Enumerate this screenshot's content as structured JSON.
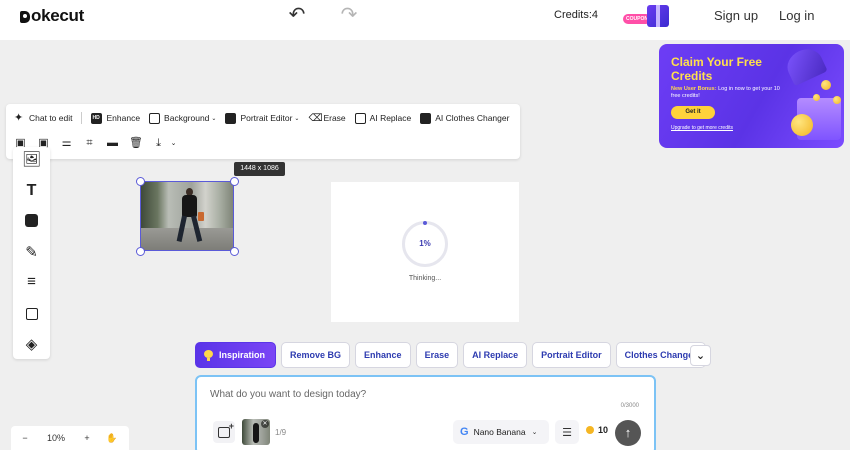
{
  "header": {
    "logo_text": "okecut",
    "credits": "Credits:4",
    "coupon_label": "COUPON",
    "signup": "Sign up",
    "login": "Log in"
  },
  "promo": {
    "title": "Claim Your Free Credits",
    "subtitle_prefix": "New User Bonus:",
    "subtitle_rest": " Log in now to get your 10 free credits!",
    "button": "Get it",
    "link": "Upgrade to get more credits"
  },
  "toolbar": {
    "chat": "Chat to edit",
    "enhance": "Enhance",
    "background": "Background",
    "portrait": "Portrait Editor",
    "erase": "Erase",
    "ai_replace": "AI Replace",
    "clothes": "AI Clothes Changer"
  },
  "canvas": {
    "size_tag": "1448 x 1086",
    "progress": "1%",
    "status": "Thinking..."
  },
  "chips": {
    "inspiration": "Inspiration",
    "remove_bg": "Remove BG",
    "enhance": "Enhance",
    "erase": "Erase",
    "ai_replace": "AI Replace",
    "portrait": "Portrait Editor",
    "clothes": "Clothes Changer"
  },
  "prompt": {
    "placeholder": "What do you want to design today?",
    "counter": "0/3000",
    "image_count": "1/9",
    "model": "Nano Banana",
    "cost": "10"
  },
  "zoom": {
    "minus": "−",
    "level": "10%",
    "plus": "+"
  },
  "colors": {
    "accent": "#5a34e8",
    "promo_title": "#ffe04d",
    "chip_text": "#2d3bb0",
    "prompt_border": "#7cc3f5"
  }
}
